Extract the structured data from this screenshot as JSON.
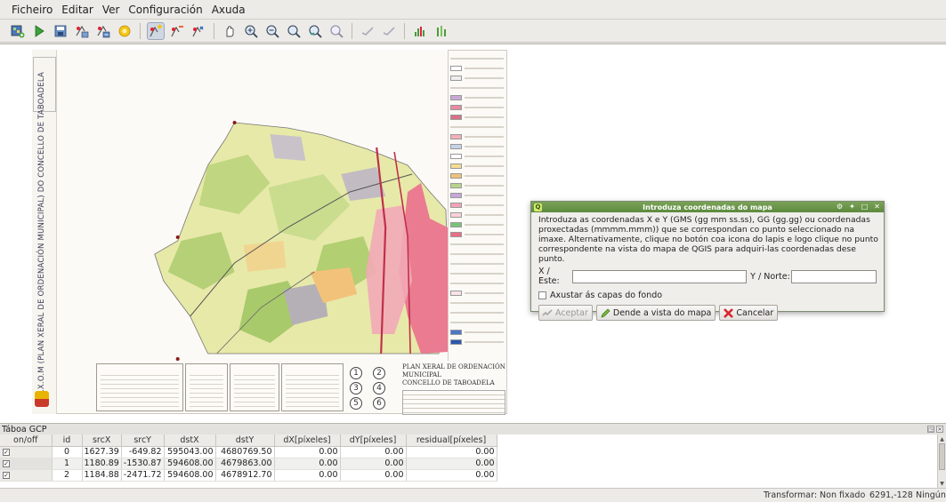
{
  "menu": [
    "Ficheiro",
    "Editar",
    "Ver",
    "Configuración",
    "Axuda"
  ],
  "toolbar": {
    "icons": [
      "add-raster-icon",
      "start-georeferencing-icon",
      "save-gcp-icon",
      "load-gcp-icon",
      "generate-gdal-script-icon",
      "settings-icon",
      "add-point-icon",
      "delete-point-icon",
      "move-point-icon",
      "pan-icon",
      "zoom-in-icon",
      "zoom-out-icon",
      "zoom-to-layer-icon",
      "zoom-last-icon",
      "zoom-next-icon",
      "link-georef-to-qgis-icon",
      "link-qgis-to-georef-icon",
      "histogram-stretch-icon",
      "full-histogram-icon"
    ]
  },
  "map": {
    "side_title": "P.X.O.M (PLAN XERAL DE ORDENACIÓN MUNICIPAL) DO CONCELLO DE TABOADELA",
    "sheet_numbers": [
      "1",
      "2",
      "3",
      "4",
      "5",
      "6"
    ],
    "plan_title_1": "PLAN XERAL DE ORDENACIÓN MUNICIPAL",
    "plan_title_2": "CONCELLO DE TABOADELA"
  },
  "dialog": {
    "title": "Introduza coordenadas do mapa",
    "description": "Introduza as coordenadas X e Y (GMS (gg mm ss.ss), GG (gg.gg) ou coordenadas proxectadas (mmmm.mmm)) que se correspondan co punto seleccionado na imaxe. Alternativamente, clique no botón coa icona do lapis e logo clique no punto correspondente na vista do mapa de QGIS para adquiri-las coordenadas dese punto.",
    "x_label": "X / Este:",
    "x_value": "",
    "y_label": "Y / Norte:",
    "y_value": "",
    "checkbox_label": "Axustar ás capas do fondo",
    "checkbox_checked": false,
    "buttons": {
      "accept": "Aceptar",
      "from_map": "Dende a vista do mapa",
      "cancel": "Cancelar"
    }
  },
  "gcp_dock": {
    "title": "Táboa GCP",
    "columns": [
      "on/off",
      "id",
      "srcX",
      "srcY",
      "dstX",
      "dstY",
      "dX[píxeles]",
      "dY[píxeles]",
      "residual[píxeles]"
    ],
    "rows": [
      {
        "enabled": true,
        "id": "0",
        "srcX": "1627.39",
        "srcY": "-649.82",
        "dstX": "595043.00",
        "dstY": "4680769.50",
        "dX": "0.00",
        "dY": "0.00",
        "residual": "0.00"
      },
      {
        "enabled": true,
        "id": "1",
        "srcX": "1180.89",
        "srcY": "-1530.87",
        "dstX": "594608.00",
        "dstY": "4679863.00",
        "dX": "0.00",
        "dY": "0.00",
        "residual": "0.00"
      },
      {
        "enabled": true,
        "id": "2",
        "srcX": "1184.88",
        "srcY": "-2471.72",
        "dstX": "594608.00",
        "dstY": "4678912.70",
        "dX": "0.00",
        "dY": "0.00",
        "residual": "0.00"
      }
    ]
  },
  "status": {
    "transform": "Transformar: Non fixado",
    "coords": "6291,-128",
    "crs": "Ningún"
  },
  "colors": {
    "dialog_title_bar": "#6a9449",
    "accent_active_tool": "#cfd7e2"
  }
}
